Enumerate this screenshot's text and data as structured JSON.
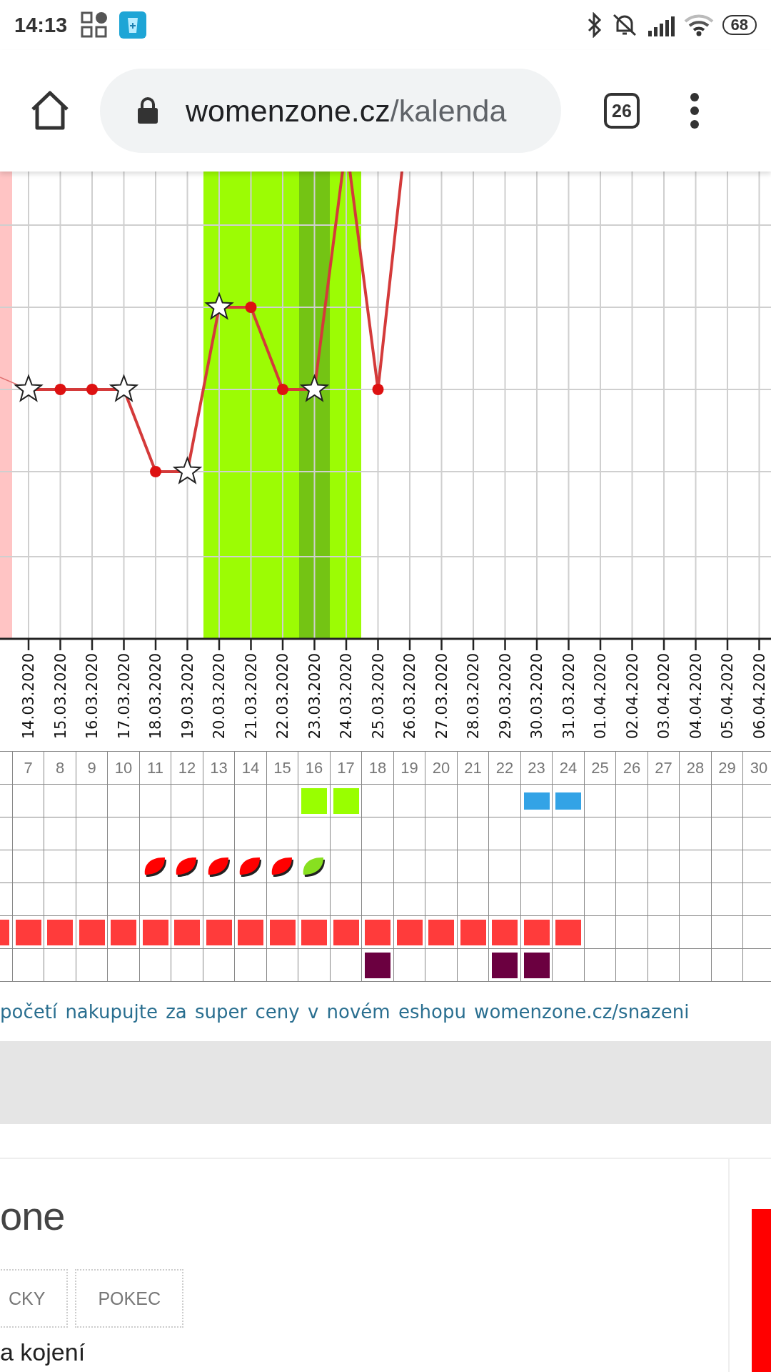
{
  "status_bar": {
    "time": "14:13",
    "battery": "68"
  },
  "address_bar": {
    "domain": "womenzone.cz",
    "path": "/kalenda",
    "tab_count": "26"
  },
  "chart": {
    "date_labels": [
      "14.03.2020",
      "15.03.2020",
      "16.03.2020",
      "17.03.2020",
      "18.03.2020",
      "19.03.2020",
      "20.03.2020",
      "21.03.2020",
      "22.03.2020",
      "23.03.2020",
      "24.03.2020",
      "25.03.2020",
      "26.03.2020",
      "27.03.2020",
      "28.03.2020",
      "29.03.2020",
      "30.03.2020",
      "31.03.2020",
      "01.04.2020",
      "02.04.2020",
      "03.04.2020",
      "04.04.2020",
      "05.04.2020",
      "06.04.2020"
    ]
  },
  "calendar": {
    "days": [
      "7",
      "8",
      "9",
      "10",
      "11",
      "12",
      "13",
      "14",
      "15",
      "16",
      "17",
      "18",
      "19",
      "20",
      "21",
      "22",
      "23",
      "24",
      "25",
      "26",
      "27",
      "28",
      "29",
      "30"
    ],
    "rows": [
      {
        "cells": [
          null,
          null,
          null,
          null,
          null,
          null,
          null,
          null,
          null,
          null,
          {
            "kind": "square",
            "color": "#99ff00"
          },
          {
            "kind": "square",
            "color": "#99ff00"
          },
          null,
          null,
          null,
          null,
          null,
          {
            "kind": "bar",
            "color": "#33a3e6"
          },
          {
            "kind": "bar",
            "color": "#33a3e6"
          },
          null,
          null,
          null,
          null,
          null,
          null
        ]
      },
      {
        "cells": [
          null,
          null,
          null,
          null,
          null,
          null,
          null,
          null,
          null,
          null,
          null,
          null,
          null,
          null,
          null,
          null,
          null,
          null,
          null,
          null,
          null,
          null,
          null,
          null,
          null
        ]
      },
      {
        "cells": [
          null,
          null,
          null,
          null,
          null,
          {
            "kind": "drop",
            "color": "#ff0000"
          },
          {
            "kind": "drop",
            "color": "#ff0000"
          },
          {
            "kind": "drop",
            "color": "#ff0000"
          },
          {
            "kind": "drop",
            "color": "#ff0000"
          },
          {
            "kind": "drop",
            "color": "#ff0000"
          },
          {
            "kind": "drop",
            "color": "#88e020"
          },
          null,
          null,
          null,
          null,
          null,
          null,
          null,
          null,
          null,
          null,
          null,
          null,
          null,
          null
        ]
      },
      {
        "cells": [
          null,
          null,
          null,
          null,
          null,
          null,
          null,
          null,
          null,
          null,
          null,
          null,
          null,
          null,
          null,
          null,
          null,
          null,
          null,
          null,
          null,
          null,
          null,
          null,
          null
        ]
      },
      {
        "cells": [
          {
            "kind": "square",
            "color": "#ff3b3b"
          },
          {
            "kind": "square",
            "color": "#ff3b3b"
          },
          {
            "kind": "square",
            "color": "#ff3b3b"
          },
          {
            "kind": "square",
            "color": "#ff3b3b"
          },
          {
            "kind": "square",
            "color": "#ff3b3b"
          },
          {
            "kind": "square",
            "color": "#ff3b3b"
          },
          {
            "kind": "square",
            "color": "#ff3b3b"
          },
          {
            "kind": "square",
            "color": "#ff3b3b"
          },
          {
            "kind": "square",
            "color": "#ff3b3b"
          },
          {
            "kind": "square",
            "color": "#ff3b3b"
          },
          {
            "kind": "square",
            "color": "#ff3b3b"
          },
          {
            "kind": "square",
            "color": "#ff3b3b"
          },
          {
            "kind": "square",
            "color": "#ff3b3b"
          },
          {
            "kind": "square",
            "color": "#ff3b3b"
          },
          {
            "kind": "square",
            "color": "#ff3b3b"
          },
          {
            "kind": "square",
            "color": "#ff3b3b"
          },
          {
            "kind": "square",
            "color": "#ff3b3b"
          },
          {
            "kind": "square",
            "color": "#ff3b3b"
          },
          {
            "kind": "square",
            "color": "#ff3b3b"
          },
          null,
          null,
          null,
          null,
          null,
          null
        ]
      },
      {
        "cells": [
          null,
          null,
          null,
          null,
          null,
          null,
          null,
          null,
          null,
          null,
          null,
          null,
          {
            "kind": "square",
            "color": "#6b0040"
          },
          null,
          null,
          null,
          {
            "kind": "square",
            "color": "#6b0040"
          },
          {
            "kind": "square",
            "color": "#6b0040"
          },
          null,
          null,
          null,
          null,
          null,
          null,
          null
        ]
      }
    ]
  },
  "promo_link": "početí nakupujte za super ceny v novém eshopu womenzone.cz/snazeni",
  "site_logo_text": "one",
  "nav_buttons": [
    "CKY",
    "POKEC"
  ],
  "article_title": "a kojení"
}
